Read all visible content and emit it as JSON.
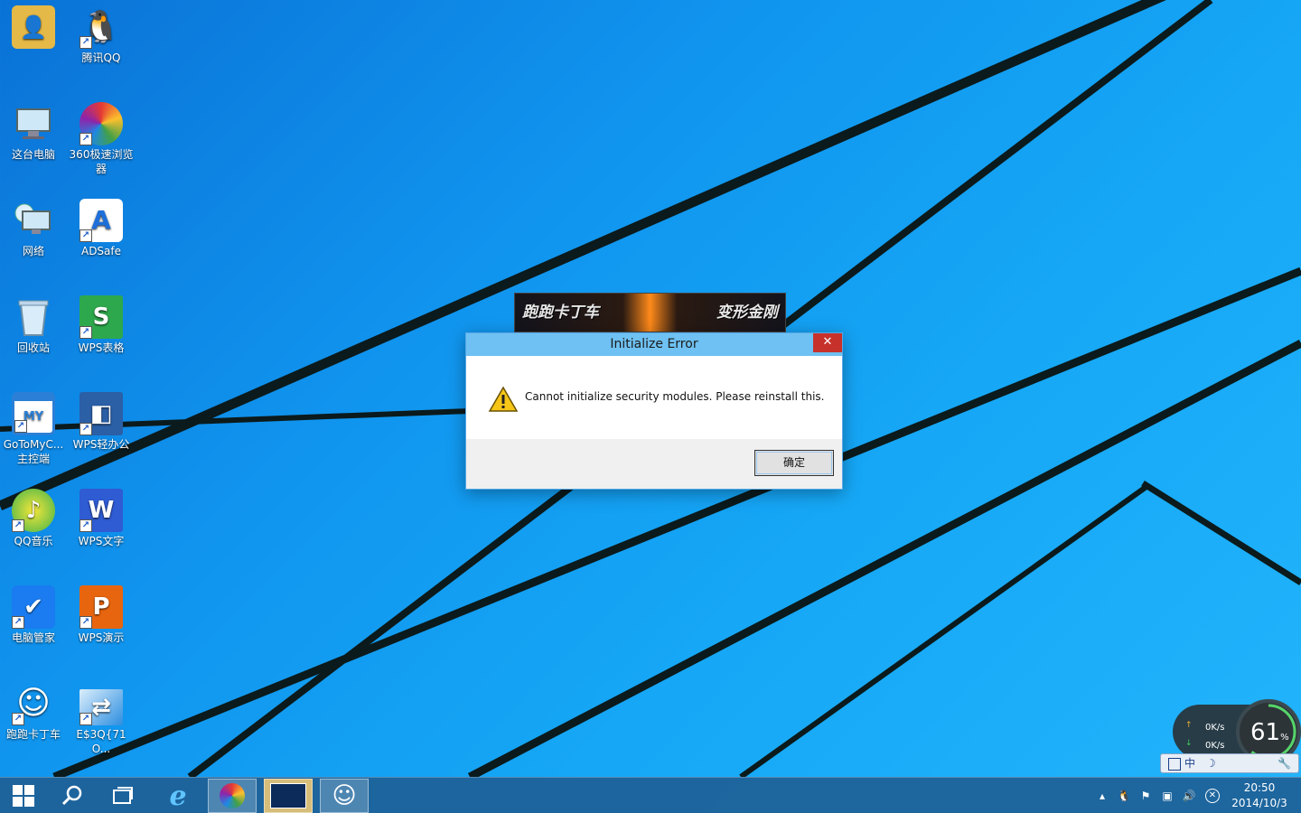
{
  "desktop": {
    "icons": [
      {
        "label": "",
        "glyph": "👤"
      },
      {
        "label": "腾讯QQ",
        "glyph": "🐧"
      },
      {
        "label": "这台电脑",
        "glyph": "🖥"
      },
      {
        "label": "360极速浏览器",
        "glyph": "✺"
      },
      {
        "label": "网络",
        "glyph": "🖥"
      },
      {
        "label": "ADSafe",
        "glyph": "A"
      },
      {
        "label": "回收站",
        "glyph": "🗑"
      },
      {
        "label": "WPS表格",
        "glyph": "S"
      },
      {
        "label": "GoToMyC... 主控端",
        "glyph": "MY"
      },
      {
        "label": "WPS轻办公",
        "glyph": "◧"
      },
      {
        "label": "QQ音乐",
        "glyph": "♪"
      },
      {
        "label": "WPS文字",
        "glyph": "W"
      },
      {
        "label": "电脑管家",
        "glyph": "✔"
      },
      {
        "label": "WPS演示",
        "glyph": "P"
      },
      {
        "label": "跑跑卡丁车",
        "glyph": "☺"
      },
      {
        "label": "E$3Q{71O...",
        "glyph": "⇄"
      }
    ]
  },
  "splash": {
    "left_text": "跑跑卡丁车",
    "right_text": "变形金刚"
  },
  "dialog": {
    "title": "Initialize Error",
    "close_label": "✕",
    "message": "Cannot initialize security modules. Please reinstall this.",
    "ok_label": "确定"
  },
  "speed_widget": {
    "upload": "0K/s",
    "download": "0K/s",
    "percent": "61",
    "percent_unit": "%"
  },
  "ime_bar": {
    "label": "中"
  },
  "taskbar": {
    "clock_time": "20:50",
    "clock_date": "2014/10/3"
  }
}
